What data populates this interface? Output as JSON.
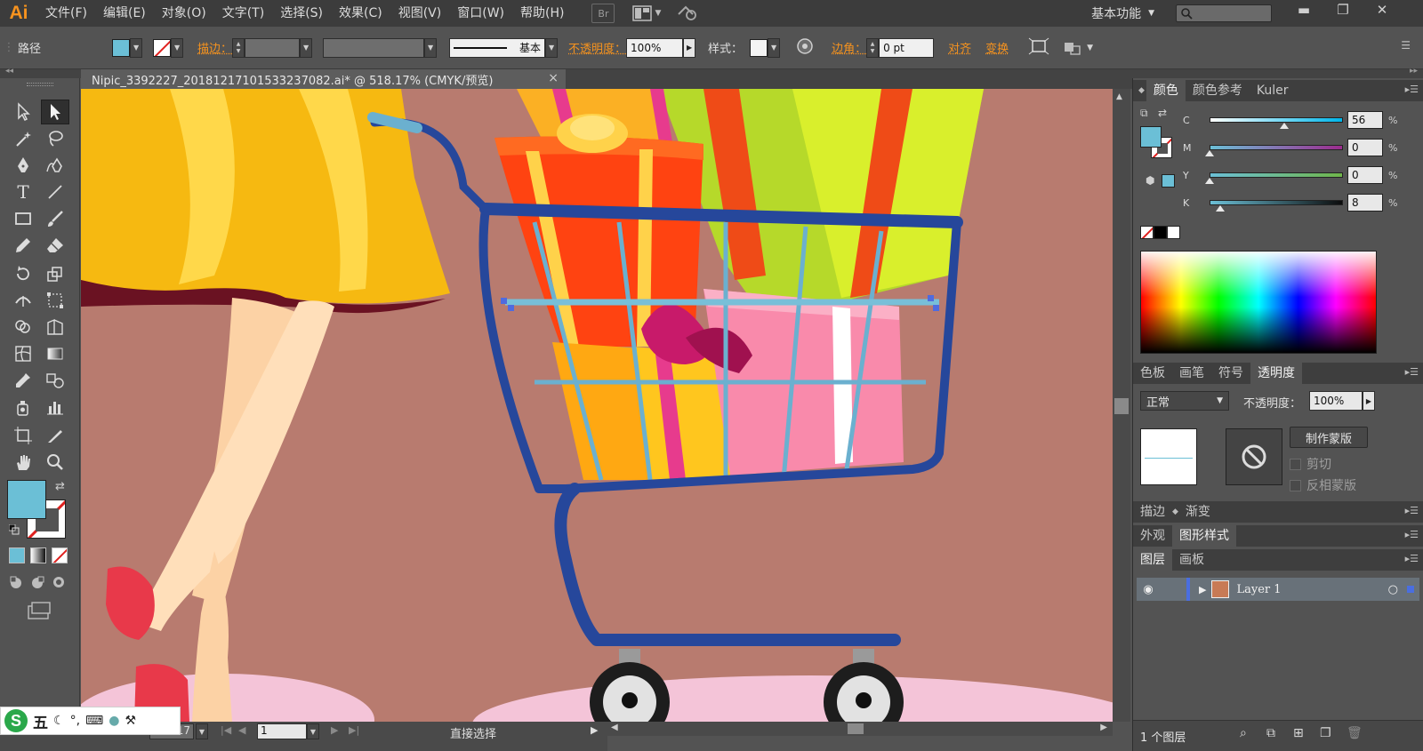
{
  "app": {
    "logo": "Ai",
    "workspace": "基本功能"
  },
  "menu": [
    "文件(F)",
    "编辑(E)",
    "对象(O)",
    "文字(T)",
    "选择(S)",
    "效果(C)",
    "视图(V)",
    "窗口(W)",
    "帮助(H)"
  ],
  "menubar_icons": {
    "bridge": "Br"
  },
  "control": {
    "selection_type": "路径",
    "stroke_label": "描边：",
    "stroke_style": "基本",
    "opacity_label": "不透明度：",
    "opacity_value": "100%",
    "style_label": "样式：",
    "corner_label": "边角：",
    "corner_value": "0 pt",
    "align_label": "对齐",
    "transform_label": "变换",
    "fill_color": "#6bbfd6"
  },
  "document": {
    "tab_title": "Nipic_3392227_20181217101533237082.ai* @ 518.17% (CMYK/预览)"
  },
  "colors": {
    "fill": "#6bbfd6",
    "canvas_bg": "#b87b6f",
    "accent": "#f7931e"
  },
  "panels": {
    "color": {
      "tabs": [
        "颜色",
        "颜色参考",
        "Kuler"
      ],
      "sliders": [
        {
          "letter": "C",
          "value": "56",
          "level": 0.56
        },
        {
          "letter": "M",
          "value": "0",
          "level": 0
        },
        {
          "letter": "Y",
          "value": "0",
          "level": 0
        },
        {
          "letter": "K",
          "value": "8",
          "level": 0.08
        }
      ],
      "pct": "%"
    },
    "transparency": {
      "tabs": [
        "色板",
        "画笔",
        "符号",
        "透明度"
      ],
      "blend_mode": "正常",
      "opacity_label": "不透明度：",
      "opacity_value": "100%",
      "make_mask": "制作蒙版",
      "clip": "剪切",
      "invert_mask": "反相蒙版"
    },
    "stroke_gradient": {
      "tabs": [
        "描边",
        "渐变"
      ]
    },
    "appearance": {
      "tabs": [
        "外观",
        "图形样式"
      ]
    },
    "layers": {
      "tabs": [
        "图层",
        "画板"
      ],
      "layer_name": "Layer 1",
      "count": "1 个图层"
    }
  },
  "status": {
    "zoom": "518.17",
    "artboard": "1",
    "tool": "直接选择"
  },
  "ime": {
    "logo": "S",
    "mode": "五"
  }
}
